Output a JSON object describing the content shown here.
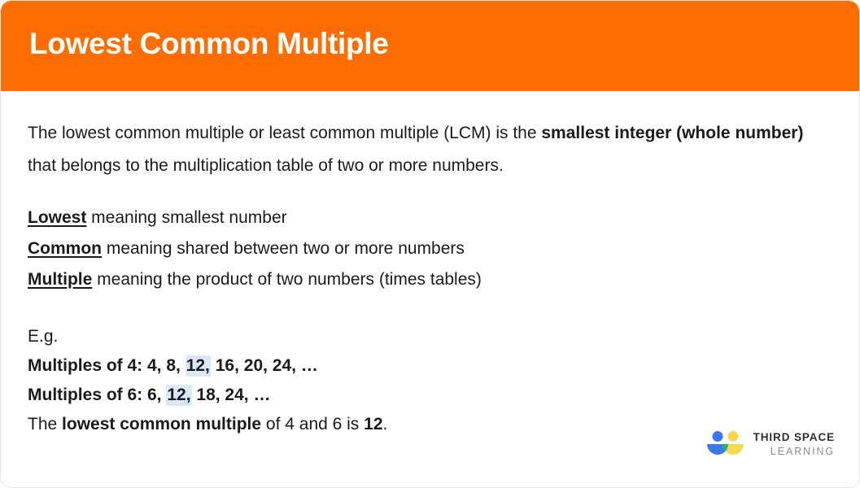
{
  "card": {
    "background": "#ffffff",
    "border_color": "#e4e7ea"
  },
  "header": {
    "title": "Lowest Common Multiple",
    "background": "#ff6d00",
    "text_color": "#ffffff"
  },
  "content": {
    "intro": {
      "part1": "The lowest common multiple or least common multiple (LCM) is the ",
      "bold1": "smallest integer (whole number)",
      "part2": " that belongs to the multiplication table of two or more numbers."
    },
    "definitions": [
      {
        "term": "Lowest",
        "meaning": " meaning smallest number"
      },
      {
        "term": "Common",
        "meaning": " meaning shared between two or more numbers"
      },
      {
        "term": "Multiple",
        "meaning": " meaning the product of two numbers (times tables)"
      }
    ],
    "example": {
      "label": "E.g.",
      "line_multiples_4": {
        "prefix": "Multiples of 4: 4, 8, ",
        "highlight": "12,",
        "suffix": " 16, 20, 24, …"
      },
      "line_multiples_6": {
        "prefix": "Multiples of 6: 6, ",
        "highlight": "12,",
        "suffix": " 18, 24, …"
      },
      "conclusion": {
        "part1": "The ",
        "bold1": "lowest common multiple",
        "part2": " of 4 and 6 is ",
        "bold2": "12",
        "part3": "."
      },
      "highlight_color": "#d9e8fb"
    }
  },
  "logo": {
    "name_top": "THIRD SPACE",
    "name_bottom": "LEARNING",
    "colors": {
      "blue": "#3a76e8",
      "yellow": "#f5d94e",
      "green": "#2aab7e",
      "text_top": "#2f2f2f",
      "text_bottom": "#8a8a8a"
    }
  }
}
